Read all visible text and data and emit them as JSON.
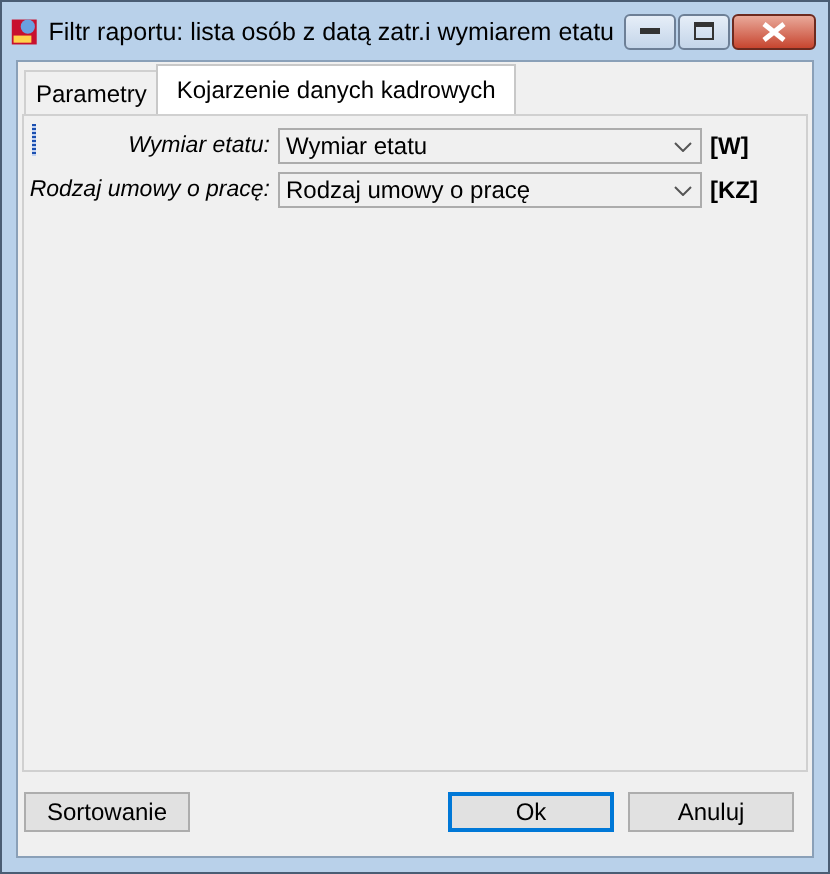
{
  "window": {
    "title": "Filtr raportu: lista osób z datą zatr.i wymiarem etatu"
  },
  "tabs": [
    {
      "label": "Parametry",
      "selected": false
    },
    {
      "label": "Kojarzenie danych kadrowych",
      "selected": true
    }
  ],
  "fields": [
    {
      "label": "Wymiar etatu:",
      "value": "Wymiar etatu",
      "code": "[W]"
    },
    {
      "label": "Rodzaj umowy o pracę:",
      "value": "Rodzaj umowy o pracę",
      "code": "[KZ]"
    }
  ],
  "buttons": [
    {
      "label": "Sortowanie",
      "default": false
    },
    {
      "label": "Ok",
      "default": true
    },
    {
      "label": "Anuluj",
      "default": false
    }
  ]
}
